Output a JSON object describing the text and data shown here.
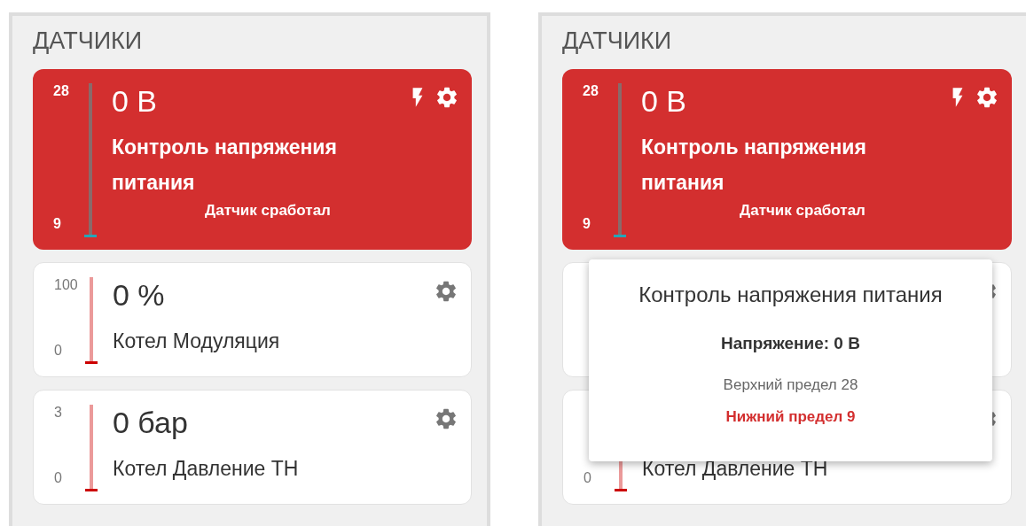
{
  "panels": [
    {
      "title": "ДАТЧИКИ",
      "sensors": [
        {
          "alarm": true,
          "trigger_icon": true,
          "max": "28",
          "min": "9",
          "value": "0 В",
          "name": "Контроль напряжения питания",
          "status": "Датчик сработал"
        },
        {
          "alarm": false,
          "trigger_icon": false,
          "max": "100",
          "min": "0",
          "value": "0 %",
          "name": "Котел Модуляция"
        },
        {
          "alarm": false,
          "trigger_icon": false,
          "max": "3",
          "min": "0",
          "value": "0 бар",
          "name": "Котел Давление ТН"
        }
      ]
    },
    {
      "title": "ДАТЧИКИ",
      "sensors": [
        {
          "alarm": true,
          "trigger_icon": true,
          "max": "28",
          "min": "9",
          "value": "0 В",
          "name": "Контроль напряжения питания",
          "status": "Датчик сработал"
        },
        {
          "alarm": false,
          "trigger_icon": false
        },
        {
          "alarm": false,
          "trigger_icon": false,
          "min": "0",
          "name": "Котел Давление ТН"
        }
      ],
      "tooltip": {
        "title": "Контроль напряжения питания",
        "reading": "Напряжение: 0 В",
        "upper": "Верхний предел 28",
        "lower": "Нижний предел 9"
      }
    }
  ]
}
